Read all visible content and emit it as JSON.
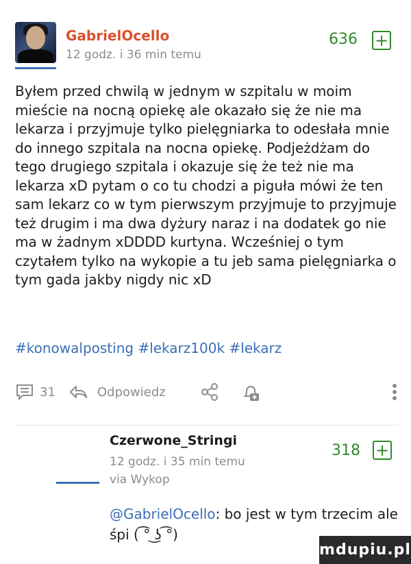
{
  "post": {
    "username": "GabrielOcello",
    "time": "12 godz. i 36 min temu",
    "score": "636",
    "plus": "+",
    "body": "Byłem przed chwilą w jednym w szpitalu w moim mieście na nocną opiekę ale okazało się że nie ma lekarza i przyjmuje tylko pielęgniarka to odesłała mnie do innego szpitala na nocna opiekę. Podjeżdżam do tego drugiego szpitala i okazuje się że też nie ma lekarza xD pytam o co tu chodzi a piguła mówi że ten sam lekarz co w tym pierwszym przyjmuje to przyjmuje też drugim i ma dwa dyżury naraz i na dodatek go nie ma w żadnym xDDDD kurtyna. Wcześniej o tym czytałem tylko na wykopie a tu jeb sama pielęgniarka o tym gada jakby nigdy nic xD",
    "tags": [
      "#konowalposting",
      "#lekarz100k",
      "#lekarz"
    ]
  },
  "actions": {
    "comments_count": "31",
    "reply_label": "Odpowiedz"
  },
  "reply": {
    "username": "Czerwone_Stringi",
    "score": "318",
    "plus": "+",
    "time": "12 godz. i 35 min temu",
    "via": "via Wykop",
    "mention": "@GabrielOcello",
    "text": ": bo jest w tym trzecim ale śpi ( ͡° ͜ʖ ͡°)"
  },
  "watermark": "mdupiu.pl",
  "colors": {
    "username": "#d9512c",
    "score": "#2f8a2a",
    "link": "#3b6fb6",
    "meta": "#8c8c8c"
  },
  "icons": [
    "comment-icon",
    "reply-arrow-icon",
    "share-icon",
    "bell-plus-icon",
    "more-vertical-icon",
    "plus-icon"
  ]
}
